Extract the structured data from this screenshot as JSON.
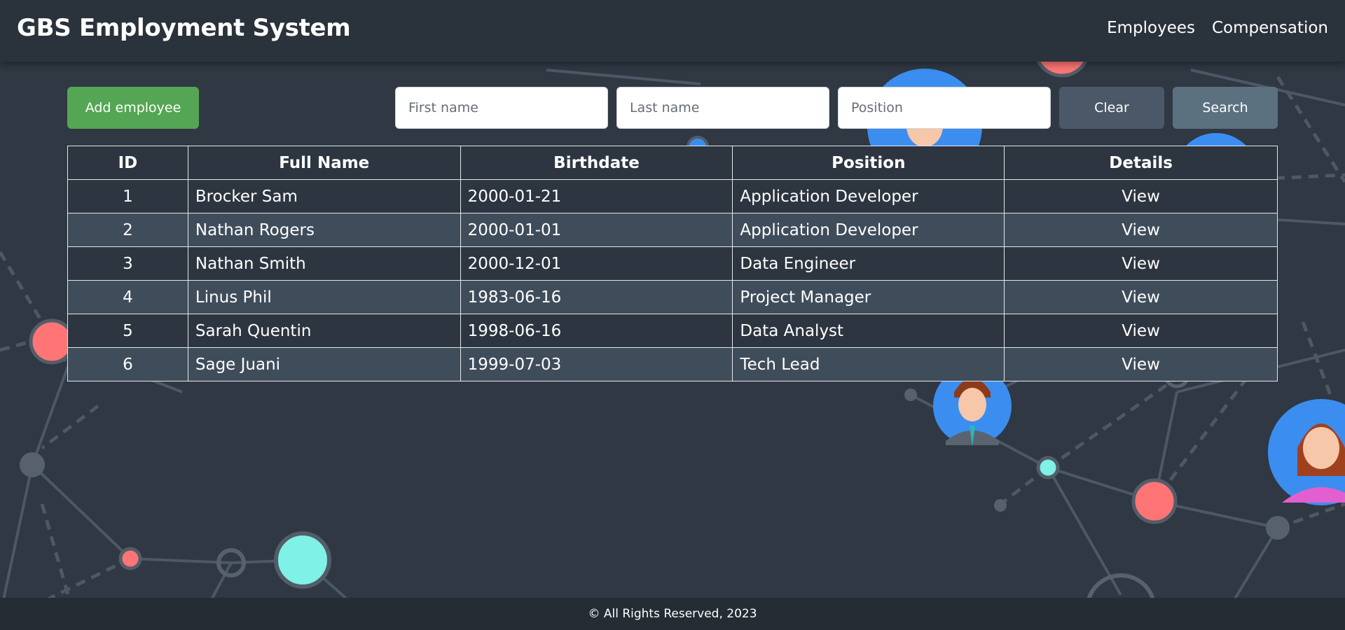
{
  "app": {
    "title": "GBS Employment System",
    "nav": [
      {
        "label": "Employees"
      },
      {
        "label": "Compensation"
      }
    ]
  },
  "toolbar": {
    "add_label": "Add employee",
    "first_name_placeholder": "First name",
    "first_name_value": "",
    "last_name_placeholder": "Last name",
    "last_name_value": "",
    "position_placeholder": "Position",
    "position_value": "",
    "clear_label": "Clear",
    "search_label": "Search"
  },
  "table": {
    "columns": [
      "ID",
      "Full Name",
      "Birthdate",
      "Position",
      "Details"
    ],
    "rows": [
      {
        "id": "1",
        "name": "Brocker Sam",
        "birthdate": "2000-01-21",
        "position": "Application Developer",
        "details": "View"
      },
      {
        "id": "2",
        "name": "Nathan Rogers",
        "birthdate": "2000-01-01",
        "position": "Application Developer",
        "details": "View"
      },
      {
        "id": "3",
        "name": "Nathan Smith",
        "birthdate": "2000-12-01",
        "position": "Data Engineer",
        "details": "View"
      },
      {
        "id": "4",
        "name": "Linus Phil",
        "birthdate": "1983-06-16",
        "position": "Project Manager",
        "details": "View"
      },
      {
        "id": "5",
        "name": "Sarah Quentin",
        "birthdate": "1998-06-16",
        "position": "Data Analyst",
        "details": "View"
      },
      {
        "id": "6",
        "name": "Sage Juani",
        "birthdate": "1999-07-03",
        "position": "Tech Lead",
        "details": "View"
      }
    ]
  },
  "footer": {
    "text": "© All Rights Reserved, 2023"
  },
  "colors": {
    "background": "#2f3843",
    "navbar": "#2a323c",
    "add_button": "#55a654",
    "clear_button": "#4a5867",
    "search_button": "#5c7180",
    "node_red": "#ff7575",
    "node_cyan": "#7ff1e6",
    "avatar_blue": "#3b8ef0"
  }
}
